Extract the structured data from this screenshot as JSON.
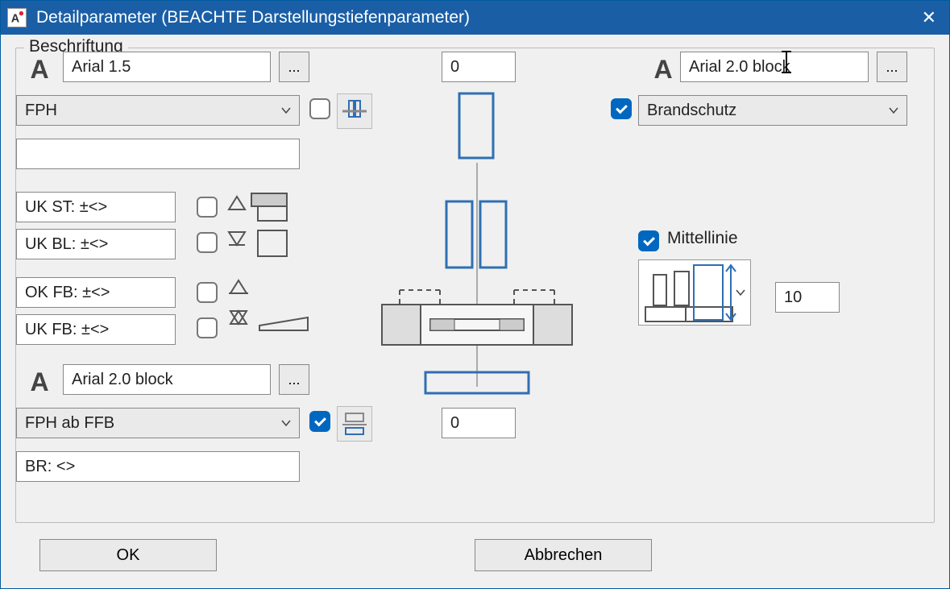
{
  "window": {
    "title": "Detailparameter (BEACHTE Darstellungstiefenparameter)"
  },
  "group": {
    "legend": "Beschriftung"
  },
  "topLeft": {
    "font": "Arial 1.5",
    "more": "...",
    "select1": "FPH",
    "chk1": false,
    "blank": ""
  },
  "topCenter": {
    "value": "0"
  },
  "topRight": {
    "font": "Arial 2.0 block",
    "more": "...",
    "chk1": true,
    "select1": "Brandschutz"
  },
  "levels": {
    "r1": "UK ST: ±<>",
    "r2": "UK BL: ±<>",
    "r3": "OK FB: ±<>",
    "r4": "UK FB: ±<>",
    "c1": false,
    "c2": false,
    "c3": false,
    "c4": false
  },
  "midRight": {
    "chk": true,
    "label": "Mittellinie",
    "value": "10"
  },
  "bottomLeft": {
    "font": "Arial 2.0 block",
    "more": "...",
    "select": "FPH ab FFB",
    "chk": true,
    "br": "BR: <>"
  },
  "bottomCenter": {
    "value": "0"
  },
  "buttons": {
    "ok": "OK",
    "cancel": "Abbrechen"
  }
}
